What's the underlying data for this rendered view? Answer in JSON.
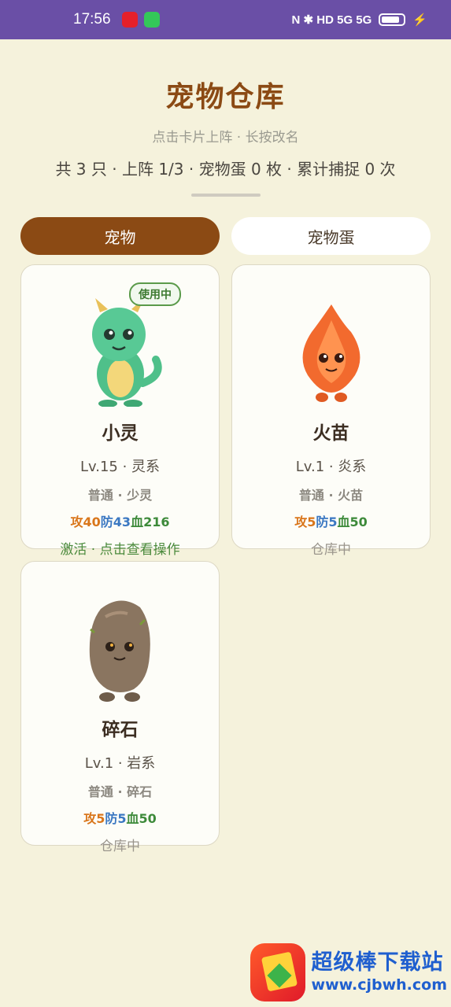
{
  "statusbar": {
    "time": "17:56",
    "icons_right": "N ✱ HD 5G 5G"
  },
  "header": {
    "title": "宠物仓库",
    "subtitle": "点击卡片上阵 · 长按改名",
    "stats": "共 3 只 · 上阵 1/3 · 宠物蛋 0 枚 · 累计捕捉 0 次"
  },
  "tabs": [
    {
      "label": "宠物",
      "active": true
    },
    {
      "label": "宠物蛋",
      "active": false
    }
  ],
  "pets": [
    {
      "name": "小灵",
      "level": "Lv.15 · 灵系",
      "kind": "普通 · 少灵",
      "atk": "攻40",
      "def": "防43",
      "hp": "血216",
      "status": "激活 · 点击查看操作",
      "badge": "使用中",
      "icon": "green-dragon",
      "color": "#4fc08a"
    },
    {
      "name": "火苗",
      "level": "Lv.1 · 炎系",
      "kind": "普通 · 火苗",
      "atk": "攻5",
      "def": "防5",
      "hp": "血50",
      "status": "仓库中",
      "icon": "fire-sprite",
      "color": "#f26a2e"
    },
    {
      "name": "碎石",
      "level": "Lv.1 · 岩系",
      "kind": "普通 · 碎石",
      "atk": "攻5",
      "def": "防5",
      "hp": "血50",
      "status": "仓库中",
      "icon": "rock-golem",
      "color": "#8a7560"
    }
  ],
  "watermark": {
    "name": "超级棒下载站",
    "url": "www.cjbwh.com"
  }
}
